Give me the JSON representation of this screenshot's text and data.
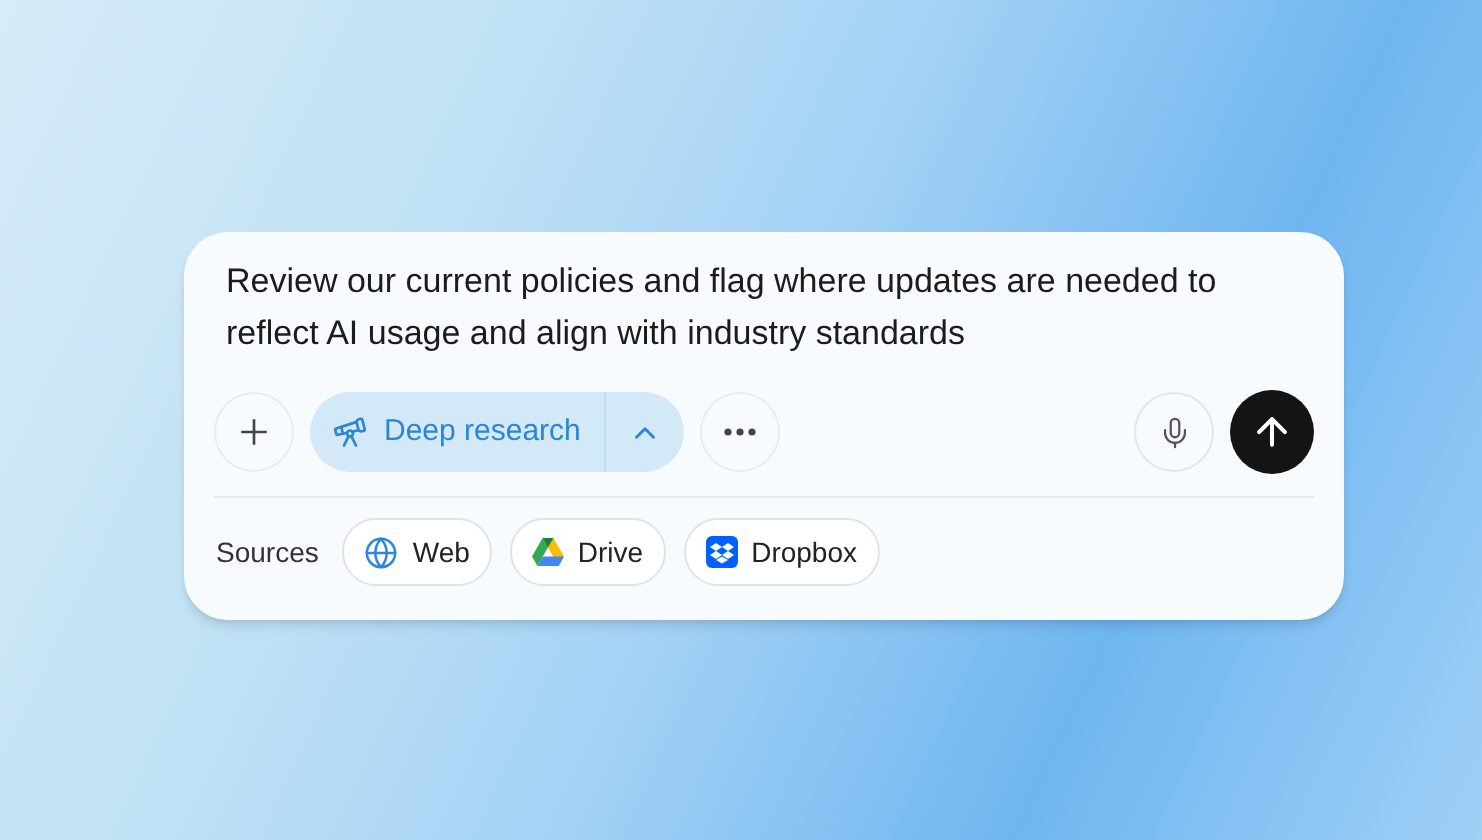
{
  "prompt": {
    "value": "Review our current policies and flag where updates are needed to reflect AI usage and align with industry standards"
  },
  "mode": {
    "label": "Deep research",
    "selected": true
  },
  "sources": {
    "label": "Sources",
    "items": [
      {
        "kind": "web",
        "label": "Web"
      },
      {
        "kind": "drive",
        "label": "Drive"
      },
      {
        "kind": "dropbox",
        "label": "Dropbox"
      }
    ]
  }
}
